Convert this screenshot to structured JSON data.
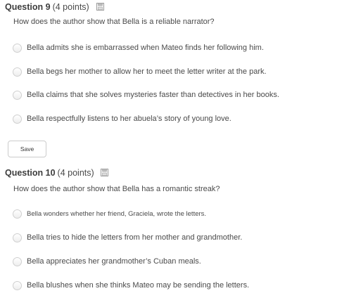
{
  "questions": [
    {
      "title": "Question 9",
      "points": "(4 points)",
      "prompt": "How does the author show that Bella is a reliable narrator?",
      "options": [
        "Bella admits she is embarrassed when Mateo finds her following him.",
        "Bella begs her mother to allow her to meet the letter writer at the park.",
        "Bella claims that she solves mysteries faster than detectives in her books.",
        "Bella respectfully listens to her abuela’s story of young love."
      ]
    },
    {
      "title": "Question 10",
      "points": "(4 points)",
      "prompt": "How does the author show that Bella has a romantic streak?",
      "options": [
        "Bella wonders whether her friend, Graciela, wrote the letters.",
        "Bella tries to hide the letters from her mother and grandmother.",
        "Bella appreciates her grandmother’s Cuban meals.",
        "Bella blushes when she thinks Mateo may be sending the letters."
      ]
    }
  ],
  "save_label": "Save",
  "icons": {
    "question_save_icon": "floppy-disk-icon",
    "option_control": "radio-button"
  },
  "colors": {
    "text": "#4a4a4a",
    "title": "#3d3d3d",
    "border": "#cccccc"
  }
}
